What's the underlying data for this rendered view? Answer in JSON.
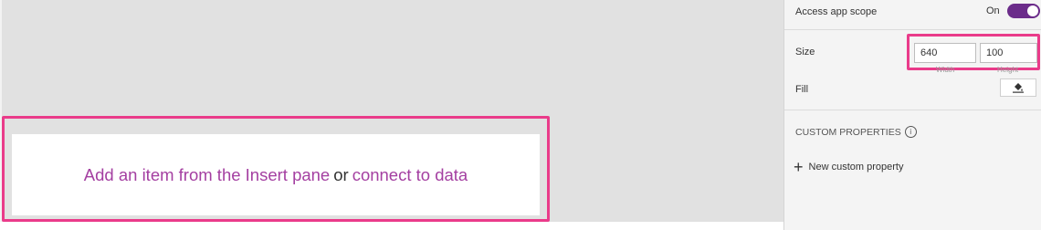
{
  "canvas": {
    "placeholder_prefix": "Add an item from the Insert pane",
    "placeholder_or": "or",
    "placeholder_link": "connect to data"
  },
  "properties": {
    "access_app_scope": {
      "label": "Access app scope",
      "state": "On"
    },
    "size": {
      "label": "Size",
      "width": "640",
      "height": "100",
      "width_sublabel": "Width",
      "height_sublabel": "Height"
    },
    "fill": {
      "label": "Fill"
    },
    "custom_properties": {
      "title": "CUSTOM PROPERTIES",
      "new_label": "New custom property"
    }
  },
  "colors": {
    "accent": "#a43fa1",
    "toggle": "#6b2c8a",
    "highlight": "#ea3b8a"
  }
}
